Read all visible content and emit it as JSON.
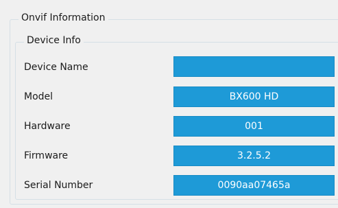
{
  "onvif_group": {
    "title": "Onvif Information"
  },
  "device_info_group": {
    "title": "Device Info",
    "rows": [
      {
        "label": "Device Name",
        "value": ""
      },
      {
        "label": "Model",
        "value": "BX600 HD"
      },
      {
        "label": "Hardware",
        "value": "001"
      },
      {
        "label": "Firmware",
        "value": "3.2.5.2"
      },
      {
        "label": "Serial Number",
        "value": "0090aa07465a"
      }
    ]
  },
  "colors": {
    "field_background": "#1e9ad7",
    "field_text": "#ffffff",
    "panel_background": "#f0f0f0",
    "group_border": "#d5dfe5"
  }
}
